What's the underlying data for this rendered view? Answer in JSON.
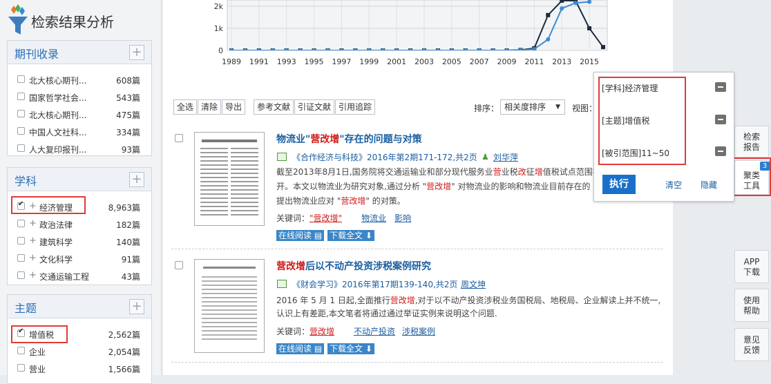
{
  "sidebar": {
    "title": "检索结果分析",
    "panels": [
      {
        "title": "期刊收录",
        "items": [
          {
            "label": "北大核心期刊...",
            "count": "608篇"
          },
          {
            "label": "国家哲学社会...",
            "count": "543篇"
          },
          {
            "label": "北大核心期刊...",
            "count": "475篇"
          },
          {
            "label": "中国人文社科...",
            "count": "334篇"
          },
          {
            "label": "人大复印报刊...",
            "count": "93篇"
          }
        ]
      },
      {
        "title": "学科",
        "items": [
          {
            "label": "经济管理",
            "count": "8,963篇",
            "checked": true
          },
          {
            "label": "政治法律",
            "count": "182篇"
          },
          {
            "label": "建筑科学",
            "count": "140篇"
          },
          {
            "label": "文化科学",
            "count": "91篇"
          },
          {
            "label": "交通运输工程",
            "count": "43篇"
          }
        ]
      },
      {
        "title": "主题",
        "items": [
          {
            "label": "增值税",
            "count": "2,562篇",
            "checked": true
          },
          {
            "label": "企业",
            "count": "2,054篇"
          },
          {
            "label": "营业",
            "count": "1,566篇"
          }
        ]
      }
    ]
  },
  "chart_data": {
    "type": "line",
    "x_tick_labels": [
      "1989",
      "1991",
      "1993",
      "1995",
      "1997",
      "1999",
      "2001",
      "2003",
      "2005",
      "2007",
      "2009",
      "2011",
      "2013",
      "2015"
    ],
    "y_tick_labels": [
      "0",
      "1k",
      "2k"
    ],
    "ylim": [
      0,
      2000
    ],
    "x_range": [
      1989,
      2016
    ],
    "series": [
      {
        "color": "#1e2a3c",
        "x": [
          1989,
          1990,
          1991,
          1992,
          1993,
          1994,
          1995,
          1996,
          1997,
          1998,
          1999,
          2000,
          2001,
          2002,
          2003,
          2004,
          2005,
          2006,
          2007,
          2008,
          2009,
          2010,
          2011,
          2012,
          2013,
          2014,
          2015,
          2016
        ],
        "values": [
          0,
          0,
          0,
          0,
          0,
          0,
          0,
          0,
          0,
          0,
          0,
          0,
          0,
          0,
          0,
          0,
          0,
          0,
          0,
          0,
          0,
          20,
          100,
          1600,
          2500,
          2800,
          1000,
          150
        ]
      },
      {
        "color": "#3a8ad6",
        "x": [
          1989,
          1990,
          1991,
          1992,
          1993,
          1994,
          1995,
          1996,
          1997,
          1998,
          1999,
          2000,
          2001,
          2002,
          2003,
          2004,
          2005,
          2006,
          2007,
          2008,
          2009,
          2010,
          2011,
          2012,
          2013,
          2014,
          2015
        ],
        "values": [
          0,
          0,
          0,
          0,
          0,
          0,
          0,
          0,
          0,
          0,
          0,
          0,
          0,
          0,
          0,
          0,
          0,
          0,
          0,
          0,
          0,
          10,
          60,
          500,
          1900,
          2150,
          2200
        ]
      }
    ]
  },
  "toolbar": {
    "buttons": [
      "全选",
      "清除",
      "导出"
    ],
    "buttons2": [
      "参考文献",
      "引证文献",
      "引用追踪"
    ],
    "sort_label": "排序：",
    "sort_value": "相关度排序",
    "view_label": "视图："
  },
  "results": [
    {
      "title_prefix": "物流业\"",
      "title_red": "营改增",
      "title_suffix": "\"存在的问题与对策",
      "source": "《合作经济与科技》2016年第2期171-172,共2页",
      "author": "刘华萍",
      "abstract_1a": "截至2013年8月1日,国务院将交通运输业和部分现代服务业",
      "abstract_1b": "营",
      "abstract_1c": "业税",
      "abstract_1d": "改",
      "abstract_1e": "征",
      "abstract_1f": "增",
      "abstract_1g": "值税试点范围在",
      "abstract_2a": "开。本文以物流业为研究对象,通过分析 \"",
      "abstract_2b": "营改增",
      "abstract_2c": "\" 对物流业的影响和物流业目前存在的",
      "abstract_3a": "提出物流业应对 \"",
      "abstract_3b": "营改增",
      "abstract_3c": "\" 的对策。",
      "kw_label": "关键词：",
      "keywords": [
        "\"营改增\"",
        "物流业",
        "影响"
      ],
      "read_online": "在线阅读",
      "download": "下载全文"
    },
    {
      "title_red": "营改增",
      "title_suffix": "后以不动产投资涉税案例研究",
      "source": "《财会学习》2016年第17期139-140,共2页",
      "author": "周文坤",
      "abstract_1a": "2016 年 5 月 1 日起,全面推行",
      "abstract_1b": "营改增",
      "abstract_1c": ",对于以不动产投资涉税业务国税局、地税局、企业解读上并不统一,",
      "abstract_2": "认识上有差距,本文笔者将通过通过举证实例来说明这个问题.",
      "kw_label": "关键词：",
      "keywords": [
        "营改增",
        "不动产投资",
        "涉税案例"
      ],
      "read_online": "在线阅读",
      "download": "下载全文"
    }
  ],
  "popup": {
    "filters": [
      "[学科]经济管理",
      "[主题]增值税",
      "[被引范围]11~50"
    ],
    "execute": "执行",
    "clear": "清空",
    "hide": "隐藏"
  },
  "right_tools": {
    "report": "检索\n报告",
    "cluster": "聚类\n工具",
    "cluster_badge": "3",
    "app": "APP\n下载",
    "help": "使用\n帮助",
    "feedback": "意见\n反馈"
  },
  "colors": {
    "accent": "#2d6fb5",
    "highlight_red": "#e03a3a",
    "button_blue": "#1a70c8"
  }
}
